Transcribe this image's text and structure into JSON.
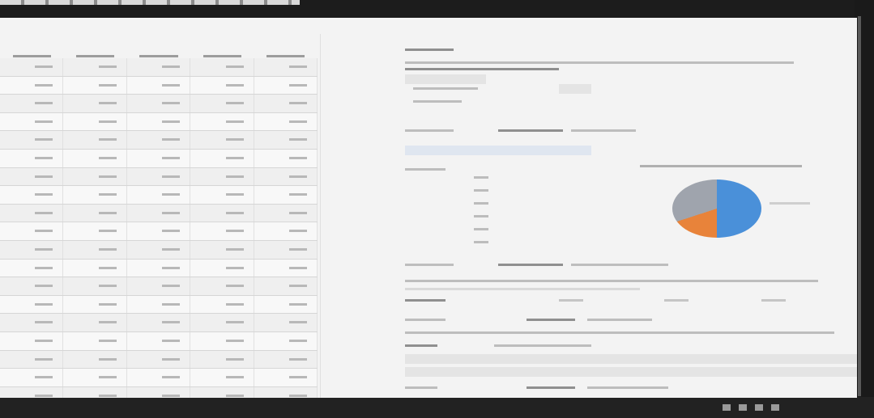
{
  "screen": {
    "grid": {
      "columns": [
        "",
        "",
        "",
        "",
        ""
      ],
      "rows": [
        [
          "",
          "",
          "",
          "",
          ""
        ],
        [
          "",
          "",
          "",
          "",
          ""
        ],
        [
          "",
          "",
          "",
          "",
          ""
        ],
        [
          "",
          "",
          "",
          "",
          ""
        ],
        [
          "",
          "",
          "",
          "",
          ""
        ],
        [
          "",
          "",
          "",
          "",
          ""
        ],
        [
          "",
          "",
          "",
          "",
          ""
        ],
        [
          "",
          "",
          "",
          "",
          ""
        ],
        [
          "",
          "",
          "",
          "",
          ""
        ],
        [
          "",
          "",
          "",
          "",
          ""
        ],
        [
          "",
          "",
          "",
          "",
          ""
        ],
        [
          "",
          "",
          "",
          "",
          ""
        ],
        [
          "",
          "",
          "",
          "",
          ""
        ],
        [
          "",
          "",
          "",
          "",
          ""
        ],
        [
          "",
          "",
          "",
          "",
          ""
        ],
        [
          "",
          "",
          "",
          "",
          ""
        ],
        [
          "",
          "",
          "",
          "",
          ""
        ],
        [
          "",
          "",
          "",
          "",
          ""
        ],
        [
          "",
          "",
          "",
          "",
          ""
        ],
        [
          "",
          "",
          "",
          "",
          ""
        ]
      ]
    },
    "pie_chart": {
      "type": "pie",
      "title": "",
      "slice_colors": [
        "#4a90d9",
        "#e8833a",
        "#9fa4ad"
      ],
      "slice_fractions": [
        0.5,
        0.2,
        0.3
      ]
    }
  },
  "taskbar": {
    "icons": [
      "app-icon",
      "app-icon",
      "app-icon",
      "app-icon"
    ]
  }
}
